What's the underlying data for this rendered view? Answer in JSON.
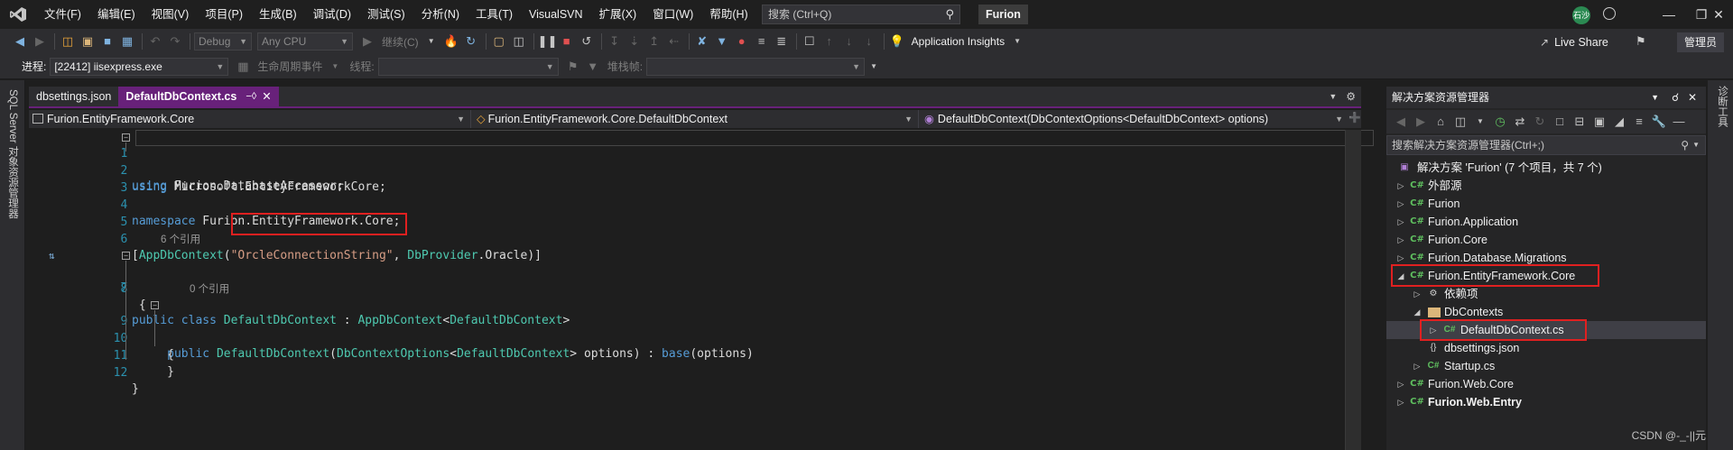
{
  "menubar": {
    "items": [
      "文件(F)",
      "编辑(E)",
      "视图(V)",
      "项目(P)",
      "生成(B)",
      "调试(D)",
      "测试(S)",
      "分析(N)",
      "工具(T)",
      "VisualSVN",
      "扩展(X)",
      "窗口(W)",
      "帮助(H)"
    ],
    "search_placeholder": "搜索 (Ctrl+Q)",
    "solution_name": "Furion",
    "avatar_initials": "石沙"
  },
  "toolbar1": {
    "config": "Debug",
    "platform": "Any CPU",
    "continue_label": "继续(C)",
    "app_insights": "Application Insights",
    "live_share": "Live Share",
    "admin_label": "管理员"
  },
  "toolbar2": {
    "process_label": "进程:",
    "process_value": "[22412] iisexpress.exe",
    "lifecycle_label": "生命周期事件",
    "thread_label": "线程:",
    "stackframe_label": "堆栈帧:"
  },
  "left_strip": {
    "label": "SQL Server 对象资源管理器"
  },
  "right_strip": {
    "label": "诊断工具"
  },
  "editor": {
    "tabs": [
      {
        "label": "dbsettings.json",
        "active": false
      },
      {
        "label": "DefaultDbContext.cs",
        "active": true
      }
    ],
    "nav": {
      "project": "Furion.EntityFramework.Core",
      "type": "Furion.EntityFramework.Core.DefaultDbContext",
      "member": "DefaultDbContext(DbContextOptions<DefaultDbContext> options)"
    },
    "code": {
      "line1": {
        "no": "1",
        "kw": "using",
        "rest": " Furion.DatabaseAccessor;"
      },
      "line2": {
        "no": "2",
        "kw": "using",
        "rest": " Microsoft.EntityFrameworkCore;"
      },
      "line3": {
        "no": "3"
      },
      "line4": {
        "no": "4",
        "kw": "namespace",
        "rest": " Furion.EntityFramework.Core;"
      },
      "line5": {
        "no": "5"
      },
      "line6": {
        "no": "6",
        "p1": "[",
        "attr": "AppDbContext",
        "p2": "(",
        "str": "\"OrcleConnectionString\"",
        "p3": ", ",
        "enum": "DbProvider",
        "p4": ".Oracle)]"
      },
      "lens6": "6 个引用",
      "line7": {
        "no": "7",
        "kw": "public class",
        "sp": " ",
        "name": "DefaultDbContext",
        "p1": " : ",
        "base": "AppDbContext",
        "lt": "<",
        "arg": "DefaultDbContext",
        "gt": ">"
      },
      "line8": {
        "no": "8",
        "text": " {"
      },
      "lens9": "0 个引用",
      "line9": {
        "no": "9",
        "indent": "     ",
        "kw": "public",
        "sp": " ",
        "name": "DefaultDbContext",
        "p1": "(",
        "t1": "DbContextOptions",
        "lt": "<",
        "t2": "DefaultDbContext",
        "gt": ">",
        "p2": " options) : ",
        "kw2": "base",
        "p3": "(options)"
      },
      "line10": {
        "no": "10",
        "text": "     {"
      },
      "line11": {
        "no": "11",
        "text": "     }"
      },
      "line12": {
        "no": "12",
        "text": "}"
      }
    }
  },
  "solution_explorer": {
    "title": "解决方案资源管理器",
    "search_placeholder": "搜索解决方案资源管理器(Ctrl+;)",
    "tree": [
      {
        "label": "解决方案 'Furion' (7 个项目，共 7 个)",
        "icon": "solution-icon"
      },
      {
        "label": "外部源",
        "icon": "project-icon"
      },
      {
        "label": "Furion",
        "icon": "project-icon"
      },
      {
        "label": "Furion.Application",
        "icon": "project-icon"
      },
      {
        "label": "Furion.Core",
        "icon": "project-icon"
      },
      {
        "label": "Furion.Database.Migrations",
        "icon": "project-icon"
      },
      {
        "label": "Furion.EntityFramework.Core",
        "icon": "project-icon"
      },
      {
        "label": "依赖项",
        "icon": "dependencies-icon"
      },
      {
        "label": "DbContexts",
        "icon": "folder-icon"
      },
      {
        "label": "DefaultDbContext.cs",
        "icon": "csharp-file-icon"
      },
      {
        "label": "dbsettings.json",
        "icon": "json-file-icon"
      },
      {
        "label": "Startup.cs",
        "icon": "csharp-file-icon"
      },
      {
        "label": "Furion.Web.Core",
        "icon": "project-icon"
      },
      {
        "label": "Furion.Web.Entry",
        "icon": "project-icon"
      }
    ]
  },
  "watermark": "CSDN @-_-||元",
  "colors": {
    "accent": "#68217a",
    "highlight_box": "#e02020",
    "keyword": "#569cd6",
    "type": "#4ec9b0",
    "string": "#d69d85"
  }
}
